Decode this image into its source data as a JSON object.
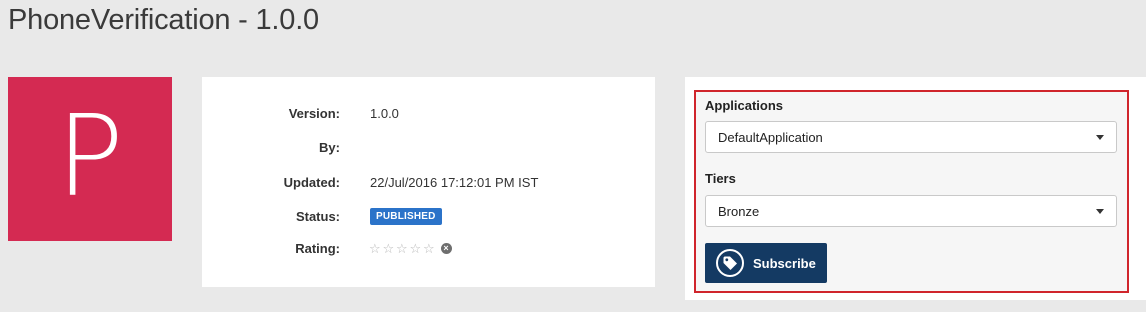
{
  "header": {
    "title": "PhoneVerification - 1.0.0"
  },
  "thumbnail": {
    "letter": "P",
    "color": "#d42a52"
  },
  "details": {
    "version_label": "Version:",
    "version_value": "1.0.0",
    "by_label": "By:",
    "by_value": "",
    "updated_label": "Updated:",
    "updated_value": "22/Jul/2016 17:12:01 PM IST",
    "status_label": "Status:",
    "status_value": "PUBLISHED",
    "rating_label": "Rating:",
    "rating_value": 0,
    "rating_max": 5,
    "star_glyph": "☆",
    "clear_glyph": "×"
  },
  "subscription": {
    "applications_label": "Applications",
    "applications_selected": "DefaultApplication",
    "tiers_label": "Tiers",
    "tiers_selected": "Bronze",
    "subscribe_label": "Subscribe",
    "highlight_color": "#d0252c",
    "button_color": "#143a63"
  }
}
